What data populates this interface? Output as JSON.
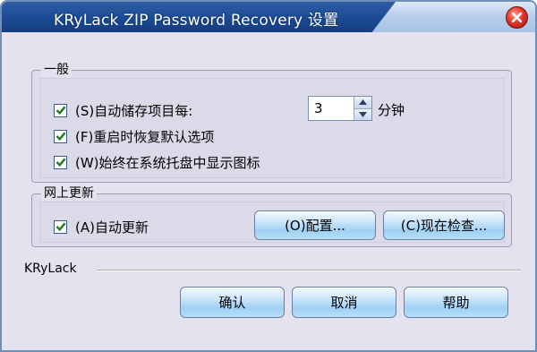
{
  "window": {
    "title": "KRyLack ZIP Password Recovery 设置"
  },
  "general": {
    "legend": "一般",
    "autosave": {
      "label": "(S)自动储存项目每:",
      "checked": true
    },
    "interval": {
      "value": "3",
      "unit": "分钟"
    },
    "restore_defaults": {
      "label": "(F)重启时恢复默认选项",
      "checked": true
    },
    "tray_icon": {
      "label": "(W)始终在系统托盘中显示图标",
      "checked": true
    }
  },
  "online_update": {
    "legend": "网上更新",
    "auto_update": {
      "label": "(A)自动更新",
      "checked": true
    },
    "configure_label": "(O)配置...",
    "check_now_label": "(C)现在检查..."
  },
  "footer": {
    "brand": "KRyLack",
    "ok_label": "确认",
    "cancel_label": "取消",
    "help_label": "帮助"
  },
  "colors": {
    "title_bar": "#1c4a93",
    "dialog_bg": "#e4e2ef",
    "button_gradient": "#9fd0f3",
    "close_red": "#e0382a"
  },
  "icons": {
    "close": "close-icon",
    "check": "check-icon",
    "spin_up": "arrow-up-icon",
    "spin_down": "arrow-down-icon"
  }
}
